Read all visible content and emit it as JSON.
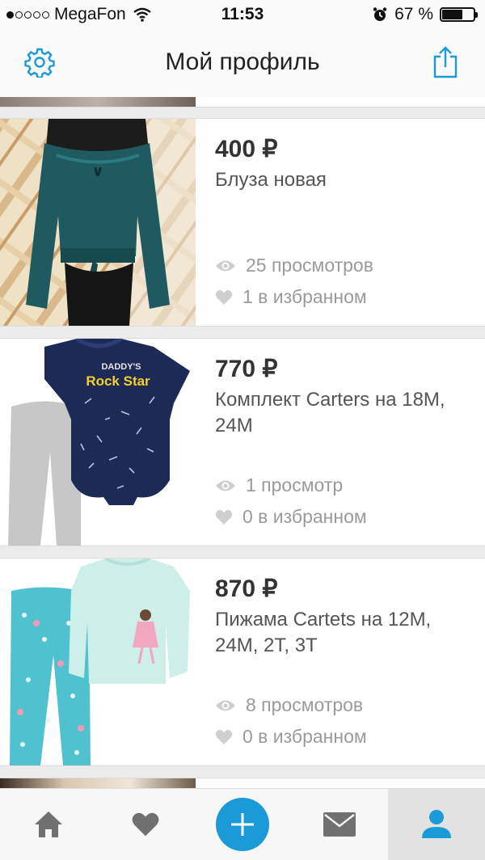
{
  "status_bar": {
    "carrier": "MegaFon",
    "time": "11:53",
    "battery_percent": "67 %",
    "battery_level": 0.67,
    "signal_bars_filled": 1,
    "signal_bars_total": 5
  },
  "header": {
    "title": "Мой профиль",
    "left_icon": "gear-icon",
    "right_icon": "share-icon"
  },
  "listings": [
    {
      "price": "400 ₽",
      "title": "Блуза новая",
      "views": "25 просмотров",
      "favorites": "1 в избранном"
    },
    {
      "price": "770 ₽",
      "title": "Комплект Carters на 18М, 24М",
      "views": "1 просмотр",
      "favorites": "0 в избранном"
    },
    {
      "price": "870 ₽",
      "title": "Пижама Cartets на 12М, 24М, 2Т, 3Т",
      "views": "8 просмотров",
      "favorites": "0 в избранном"
    }
  ],
  "tab_bar": {
    "items": [
      "home-icon",
      "heart-icon",
      "add-icon",
      "mail-icon",
      "profile-icon"
    ],
    "active": "profile-icon"
  },
  "colors": {
    "accent": "#1a9bd7",
    "stat_text": "#9a9a9a",
    "icon_gray": "#707070"
  }
}
